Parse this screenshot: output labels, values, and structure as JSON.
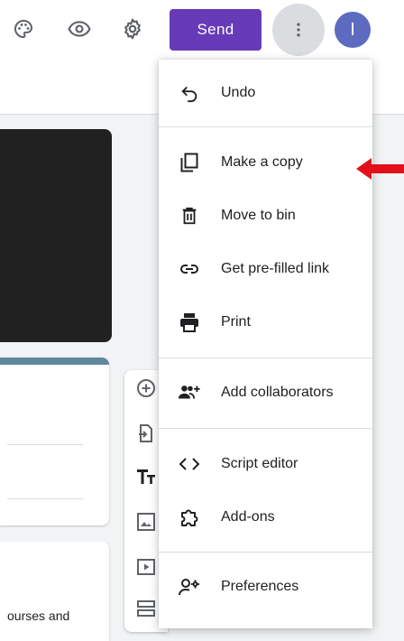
{
  "topbar": {
    "icons": [
      "palette-icon",
      "eye-icon",
      "gear-icon"
    ],
    "send_label": "Send",
    "more_icon": "more-vert-icon",
    "avatar_initial": "I"
  },
  "menu": {
    "items": [
      {
        "label": "Undo",
        "icon": "undo-icon"
      },
      {
        "label": "Make a copy",
        "icon": "copy-icon"
      },
      {
        "label": "Move to bin",
        "icon": "trash-icon"
      },
      {
        "label": "Get pre-filled link",
        "icon": "link-icon"
      },
      {
        "label": "Print",
        "icon": "printer-icon"
      },
      {
        "label": "Add collaborators",
        "icon": "add-people-icon"
      },
      {
        "label": "Script editor",
        "icon": "code-icon"
      },
      {
        "label": "Add-ons",
        "icon": "puzzle-icon"
      },
      {
        "label": "Preferences",
        "icon": "person-settings-icon"
      }
    ]
  },
  "content": {
    "partial_text": "ourses and"
  },
  "side_toolbar": {
    "icons": [
      "add-circle-icon",
      "import-icon",
      "title-icon",
      "image-icon",
      "video-icon",
      "section-icon"
    ]
  },
  "annotation": {
    "arrow_color": "#e3101b"
  },
  "colors": {
    "accent": "#673ab7",
    "avatar": "#5c6bc0",
    "header_bar": "#5f889d"
  }
}
